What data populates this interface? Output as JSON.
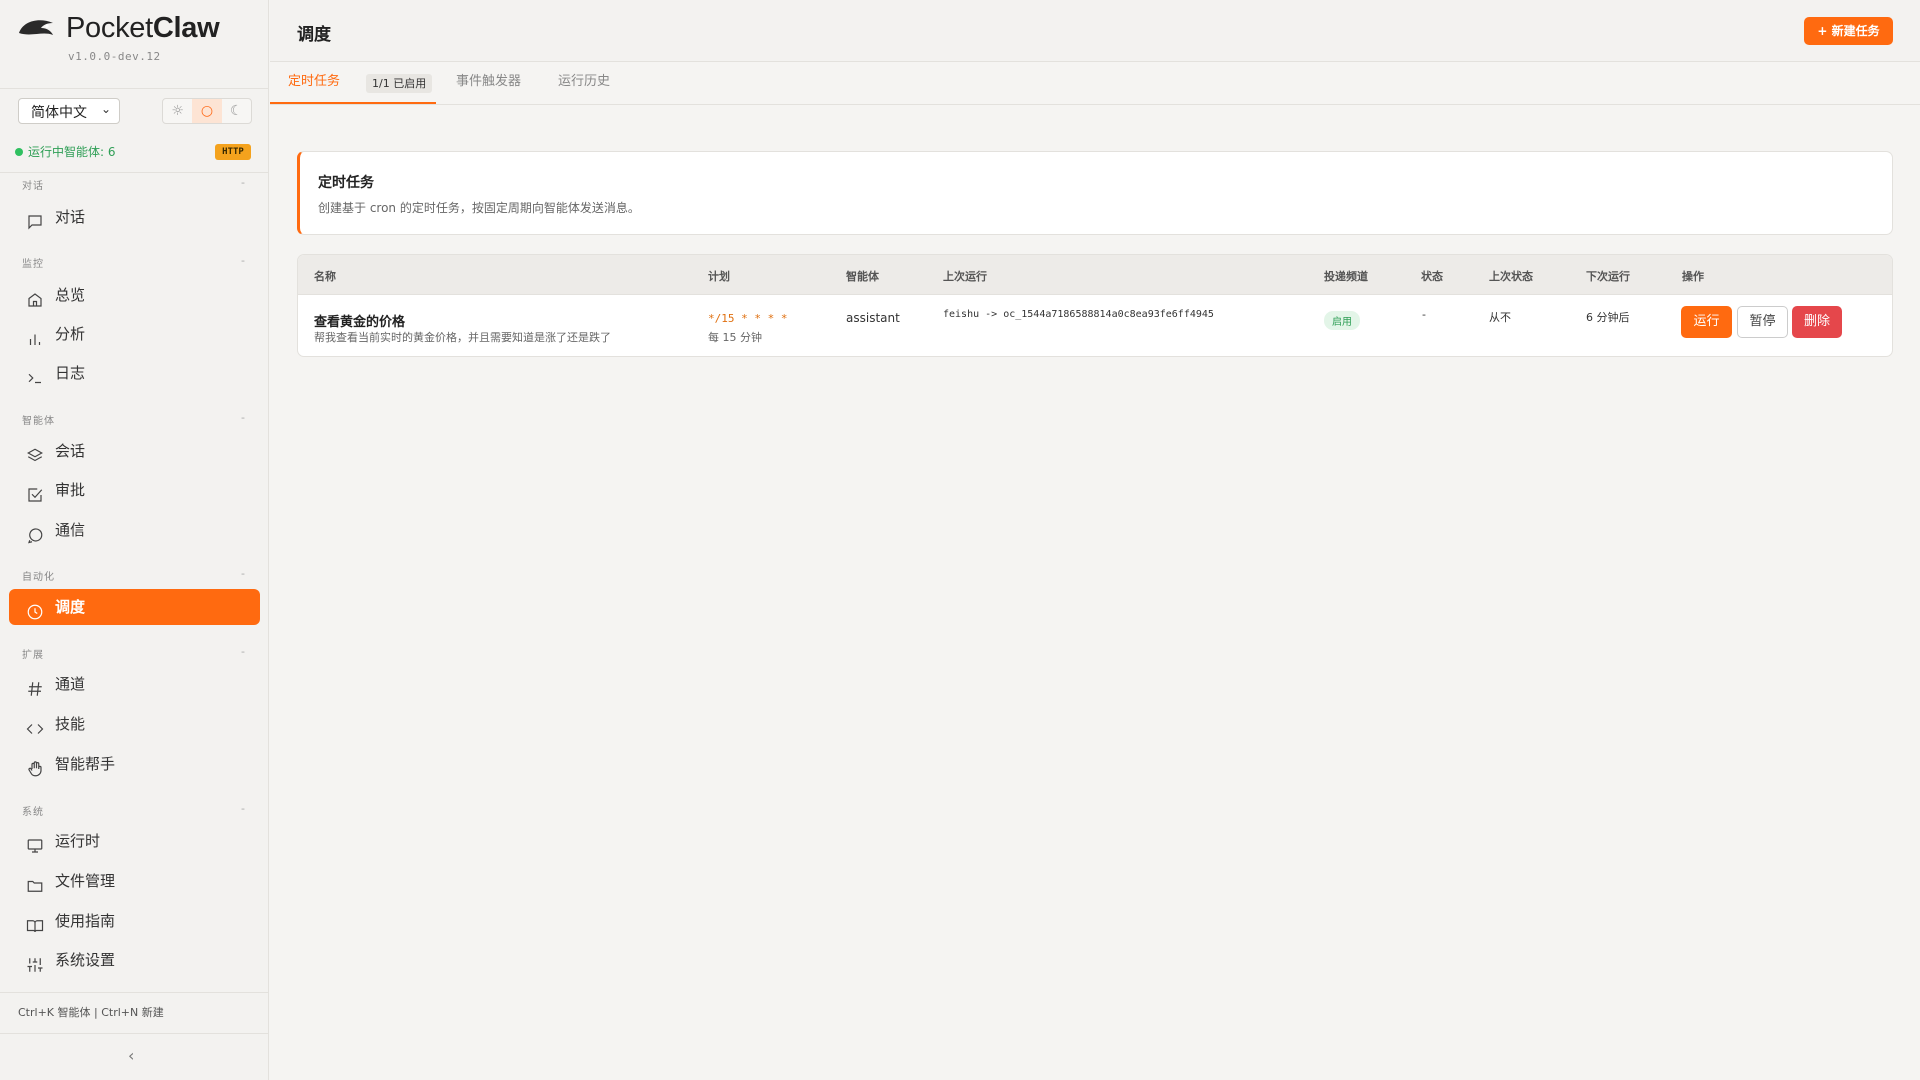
{
  "brand": {
    "name_light": "Pocket",
    "name_bold": "Claw",
    "version": "v1.0.0-dev.12"
  },
  "sidebar": {
    "language": "简体中文",
    "theme_options": [
      {
        "icon": "sun-icon",
        "glyph": "☼"
      },
      {
        "icon": "circle-icon",
        "glyph": "○"
      },
      {
        "icon": "moon-icon",
        "glyph": "☾"
      }
    ],
    "running_status": "运行中智能体: 6",
    "transport_badge": "HTTP",
    "sections": [
      {
        "label": "对话",
        "items": [
          {
            "label": "对话",
            "icon": "chat-icon"
          }
        ]
      },
      {
        "label": "监控",
        "items": [
          {
            "label": "总览",
            "icon": "home-icon"
          },
          {
            "label": "分析",
            "icon": "bar-chart-icon"
          },
          {
            "label": "日志",
            "icon": "terminal-icon"
          }
        ]
      },
      {
        "label": "智能体",
        "items": [
          {
            "label": "会话",
            "icon": "layers-icon"
          },
          {
            "label": "审批",
            "icon": "checkbox-icon"
          },
          {
            "label": "通信",
            "icon": "message-circle-icon"
          }
        ]
      },
      {
        "label": "自动化",
        "items": [
          {
            "label": "调度",
            "icon": "clock-icon",
            "active": true
          }
        ]
      },
      {
        "label": "扩展",
        "items": [
          {
            "label": "通道",
            "icon": "hash-icon"
          },
          {
            "label": "技能",
            "icon": "code-icon"
          },
          {
            "label": "智能帮手",
            "icon": "hand-icon"
          }
        ]
      },
      {
        "label": "系统",
        "items": [
          {
            "label": "运行时",
            "icon": "monitor-icon"
          },
          {
            "label": "文件管理",
            "icon": "folder-icon"
          },
          {
            "label": "使用指南",
            "icon": "book-icon"
          },
          {
            "label": "系统设置",
            "icon": "sliders-icon"
          }
        ]
      }
    ],
    "shortcuts": "Ctrl+K 智能体 | Ctrl+N 新建",
    "collapse_glyph": "‹"
  },
  "header": {
    "title": "调度",
    "new_button": "+ 新建任务"
  },
  "tabs": [
    {
      "label": "定时任务",
      "active": true,
      "badge": "1/1 已启用"
    },
    {
      "label": "事件触发器"
    },
    {
      "label": "运行历史"
    }
  ],
  "info_card": {
    "title": "定时任务",
    "description": "创建基于 cron 的定时任务，按固定周期向智能体发送消息。"
  },
  "table": {
    "columns": [
      "名称",
      "计划",
      "智能体",
      "上次运行",
      "投递频道",
      "状态",
      "上次状态",
      "下次运行",
      "操作"
    ],
    "rows": [
      {
        "name": "查看黄金的价格",
        "description": "帮我查看当前实时的黄金价格，并且需要知道是涨了还是跌了",
        "cron": "*/15 * * * *",
        "schedule_text": "每 15 分钟",
        "agent": "assistant",
        "last_run": "feishu -> oc_1544a7186588814a0c8ea93fe6ff4945",
        "delivery": "启用",
        "status": "-",
        "last_status": "从不",
        "next_run": "6 分钟后",
        "actions": {
          "run": "运行",
          "pause": "暂停",
          "delete": "删除"
        }
      }
    ]
  },
  "colors": {
    "accent": "#ff6a10",
    "danger": "#e5474b",
    "success": "#2e9e55",
    "badge": "#f4a21d"
  }
}
